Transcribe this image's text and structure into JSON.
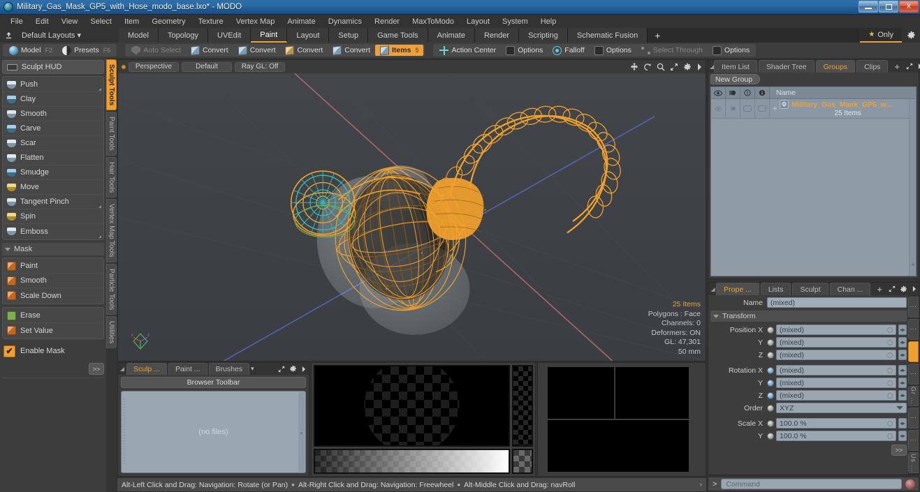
{
  "window": {
    "title": "Military_Gas_Mask_GP5_with_Hose_modo_base.lxo* - MODO",
    "app_icon": "modo-sphere-icon",
    "minimize": "minimize-icon",
    "maximize": "maximize-icon",
    "close": "X"
  },
  "menubar": {
    "items": [
      "File",
      "Edit",
      "View",
      "Select",
      "Item",
      "Geometry",
      "Texture",
      "Vertex Map",
      "Animate",
      "Dynamics",
      "Render",
      "MaxToModo",
      "Layout",
      "System",
      "Help"
    ]
  },
  "layoutbar": {
    "preset_label": "Default Layouts",
    "preset_caret": "▾",
    "tabs": [
      {
        "label": "Model",
        "active": false
      },
      {
        "label": "Topology",
        "active": false
      },
      {
        "label": "UVEdit",
        "active": false
      },
      {
        "label": "Paint",
        "active": true
      },
      {
        "label": "Layout",
        "active": false
      },
      {
        "label": "Setup",
        "active": false
      },
      {
        "label": "Game Tools",
        "active": false
      },
      {
        "label": "Animate",
        "active": false
      },
      {
        "label": "Render",
        "active": false
      },
      {
        "label": "Scripting",
        "active": false
      },
      {
        "label": "Schematic Fusion",
        "active": false
      }
    ],
    "add_tab": "+",
    "only_label": "Only",
    "star_icon": "star-icon",
    "gear_icon": "gear-icon"
  },
  "modebar": {
    "left": [
      {
        "label": "Model",
        "key": "F2",
        "icon": "sphere-icon",
        "state": "normal"
      },
      {
        "label": "Presets",
        "key": "F6",
        "icon": "half-sphere-icon",
        "state": "normal"
      }
    ],
    "right": [
      {
        "label": "Auto Select",
        "icon": "shield-icon",
        "state": "dim"
      },
      {
        "label": "Convert",
        "icon": "cube-blue-icon",
        "state": "normal"
      },
      {
        "label": "Convert",
        "icon": "cube-blue-icon",
        "state": "normal"
      },
      {
        "label": "Convert",
        "icon": "cube-yellow-icon",
        "state": "normal"
      },
      {
        "label": "Convert",
        "icon": "cube-blue-icon",
        "state": "normal"
      },
      {
        "label": "Items",
        "key": "5",
        "icon": "cube-blue-icon",
        "state": "active"
      }
    ],
    "tools": [
      {
        "label": "Action Center",
        "icon": "crosshair-icon",
        "state": "normal"
      },
      {
        "label": "Options",
        "icon": "checkbox-icon",
        "state": "normal"
      },
      {
        "label": "Falloff",
        "icon": "target-icon",
        "state": "normal"
      },
      {
        "label": "Options",
        "icon": "checkbox-icon",
        "state": "normal"
      },
      {
        "label": "Select Through",
        "icon": "dots-icon",
        "state": "dim"
      },
      {
        "label": "Options",
        "icon": "checkbox-icon",
        "state": "normal"
      }
    ]
  },
  "sculpt_panel": {
    "hud_button": "Sculpt HUD",
    "hud_icon": "hud-icon",
    "brush_tools": [
      {
        "label": "Push",
        "icon": "brush-push-icon"
      },
      {
        "label": "Clay",
        "icon": "brush-clay-icon"
      },
      {
        "label": "Smooth",
        "icon": "brush-smooth-icon"
      },
      {
        "label": "Carve",
        "icon": "brush-carve-icon"
      },
      {
        "label": "Scar",
        "icon": "brush-scar-icon"
      },
      {
        "label": "Flatten",
        "icon": "brush-flatten-icon"
      },
      {
        "label": "Smudge",
        "icon": "brush-smudge-icon"
      },
      {
        "label": "Move",
        "icon": "brush-move-icon"
      },
      {
        "label": "Tangent Pinch",
        "icon": "brush-tangent-pinch-icon"
      },
      {
        "label": "Spin",
        "icon": "brush-spin-icon"
      },
      {
        "label": "Emboss",
        "icon": "brush-emboss-icon"
      }
    ],
    "mask_section": "Mask",
    "mask_tools": [
      {
        "label": "Paint",
        "icon": "mask-paint-icon"
      },
      {
        "label": "Smooth",
        "icon": "mask-smooth-icon"
      },
      {
        "label": "Scale Down",
        "icon": "mask-scale-down-icon"
      }
    ],
    "mask_tools2": [
      {
        "label": "Erase",
        "icon": "mask-erase-icon"
      },
      {
        "label": "Set Value",
        "icon": "mask-set-value-icon"
      }
    ],
    "enable_mask": "Enable Mask",
    "enable_mask_checked": true,
    "more_button": ">>"
  },
  "left_vtabs": [
    {
      "label": "Sculpt Tools",
      "active": true
    },
    {
      "label": "Paint Tools",
      "active": false
    },
    {
      "label": "Hair Tools",
      "active": false
    },
    {
      "label": "Vertex Map Tools",
      "active": false
    },
    {
      "label": "Particle Tools",
      "active": false
    },
    {
      "label": "Utilities",
      "active": false
    }
  ],
  "viewport": {
    "view_mode": "Perspective",
    "shading": "Default",
    "raygl": "Ray GL: Off",
    "tools": [
      "move-icon",
      "rotate-icon",
      "zoom-icon",
      "fit-icon",
      "gear-icon",
      "chevron-right-icon"
    ],
    "stats": {
      "items": "25 Items",
      "polygons": "Polygons : Face",
      "channels": "Channels: 0",
      "deformers": "Deformers: ON",
      "gl": "GL: 47,301",
      "scale": "50 mm"
    },
    "axis_gizmo": "axis-gizmo-icon"
  },
  "browser_panel": {
    "tabs": [
      {
        "label": "Sculp ...",
        "active": true
      },
      {
        "label": "Paint ...",
        "active": false
      },
      {
        "label": "Brushes",
        "active": false
      }
    ],
    "dropdown": "▾",
    "toolbar_label": "Browser Toolbar",
    "empty_text": "(no files)",
    "expand_icon": "expand-icon",
    "gear_icon": "gear-icon",
    "chevron_icon": "chevron-right-icon"
  },
  "groups_panel": {
    "tabs": [
      {
        "label": "Item List",
        "active": false
      },
      {
        "label": "Shader Tree",
        "active": false
      },
      {
        "label": "Groups",
        "active": true
      },
      {
        "label": "Clips",
        "active": false
      }
    ],
    "add_tab": "+",
    "new_group_button": "New Group",
    "columns": [
      "eye-icon",
      "render-icon",
      "lock-icon",
      "info-icon",
      "Name"
    ],
    "rows": [
      {
        "name": "Military_Gas_Mask_GP5_w...",
        "subtitle": "25 Items",
        "icon": "group-mask-icon",
        "expand": "+"
      }
    ]
  },
  "properties_panel": {
    "tabs": [
      {
        "label": "Prope ...",
        "active": true
      },
      {
        "label": "Lists",
        "active": false
      },
      {
        "label": "Sculpt",
        "active": false
      },
      {
        "label": "Chan ...",
        "active": false
      }
    ],
    "add_tab": "+",
    "name_label": "Name",
    "name_value": "(mixed)",
    "transform_section": "Transform",
    "fields": [
      {
        "label": "Position X",
        "value": "(mixed)",
        "dot": "grey",
        "type": "field"
      },
      {
        "label": "Y",
        "value": "(mixed)",
        "dot": "grey",
        "type": "field"
      },
      {
        "label": "Z",
        "value": "(mixed)",
        "dot": "grey",
        "type": "field"
      },
      {
        "label": "Rotation X",
        "value": "(mixed)",
        "dot": "blue",
        "type": "field"
      },
      {
        "label": "Y",
        "value": "(mixed)",
        "dot": "blue",
        "type": "field"
      },
      {
        "label": "Z",
        "value": "(mixed)",
        "dot": "blue",
        "type": "field"
      },
      {
        "label": "Order",
        "value": "XYZ",
        "dot": "grey",
        "type": "dropdown"
      },
      {
        "label": "Scale X",
        "value": "100.0 %",
        "dot": "grey",
        "type": "field"
      },
      {
        "label": "Y",
        "value": "100.0 %",
        "dot": "grey",
        "type": "field"
      }
    ],
    "more_button": ">>",
    "side_tabs": [
      {
        "label": "",
        "active": false
      },
      {
        "label": "",
        "active": false
      },
      {
        "label": "",
        "active": true
      },
      {
        "label": "",
        "active": false
      },
      {
        "label": "Gr ...",
        "active": false
      },
      {
        "label": "",
        "active": false
      },
      {
        "label": "",
        "active": false
      },
      {
        "label": "Us ...",
        "active": false
      }
    ]
  },
  "statusbar": {
    "hints": [
      "Alt-Left Click and Drag: Navigation: Rotate (or Pan)",
      "Alt-Right Click and Drag: Navigation: Freewheel",
      "Alt-Middle Click and Drag: navRoll"
    ],
    "separator": "●",
    "more": "›"
  },
  "commandbar": {
    "prompt": ">",
    "placeholder": "Command",
    "record_icon": "record-icon"
  },
  "colors": {
    "accent": "#f0a030",
    "wireframe": "#f5a623",
    "viewport_bg": "#3e4246",
    "panel_bg": "#3d3d3d",
    "field_bg": "#9aa7b0"
  }
}
